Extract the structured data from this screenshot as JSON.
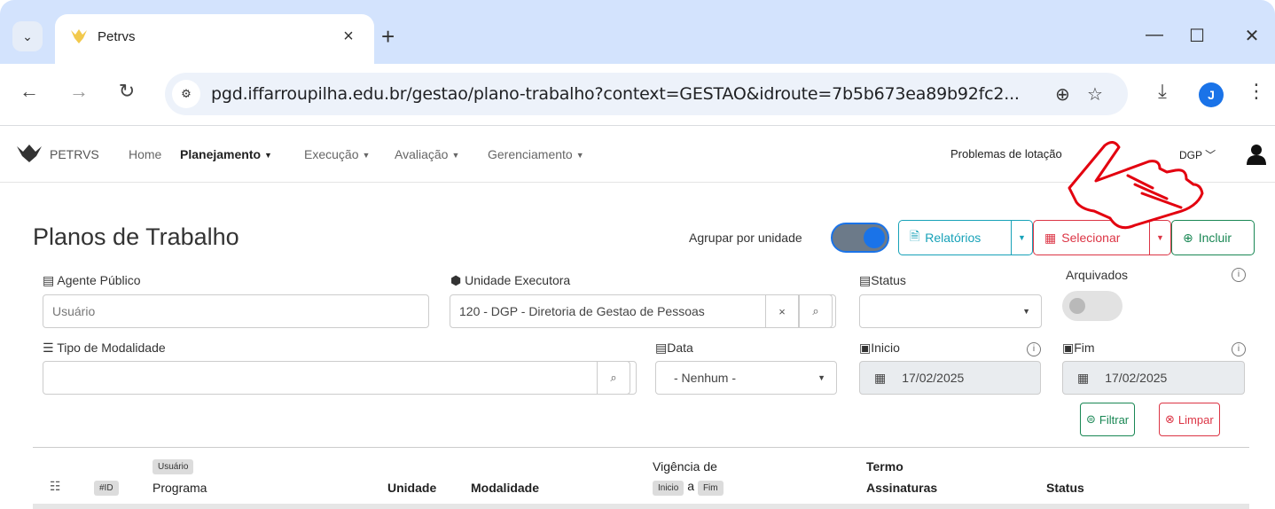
{
  "browser": {
    "tab_title": "Petrvs",
    "tab_close": "×",
    "new_tab": "+",
    "url": "pgd.iffarroupilha.edu.br/gestao/plano-trabalho?context=GESTAO&idroute=7b5b673ea89b92fc2...",
    "profile_initial": "J",
    "icons": [
      "tab-search-icon",
      "back-icon",
      "forward-icon",
      "reload-icon",
      "site-settings-icon",
      "zoom-icon",
      "bookmark-star-icon",
      "download-icon",
      "menu-dots-icon",
      "minimize-icon",
      "maximize-icon",
      "close-icon"
    ]
  },
  "nav": {
    "brand": "PETRVS",
    "items": [
      {
        "label": "Home",
        "bold": false,
        "caret": false
      },
      {
        "label": "Planejamento",
        "bold": true,
        "caret": true
      },
      {
        "label": "Execução",
        "bold": false,
        "caret": true
      },
      {
        "label": "Avaliação",
        "bold": false,
        "caret": true
      },
      {
        "label": "Gerenciamento",
        "bold": false,
        "caret": true
      }
    ],
    "problems": "Problemas de lotação",
    "unit": "DGP"
  },
  "page": {
    "title": "Planos de Trabalho",
    "group_label": "Agrupar por unidade",
    "group_toggle_on": true,
    "buttons": {
      "reports": "Relatórios",
      "select": "Selecionar",
      "include": "Incluir"
    }
  },
  "filters": {
    "agent_label": "Agente Público",
    "agent_placeholder": "Usuário",
    "unit_label": "Unidade Executora",
    "unit_value": "120 - DGP - Diretoria de Gestao de Pessoas",
    "unit_clear": "×",
    "status_label": "Status",
    "archived_label": "Arquivados",
    "modality_label": "Tipo de Modalidade",
    "date_label": "Data",
    "date_value": "- Nenhum -",
    "start_label": "Inicio",
    "start_value": "17/02/2025",
    "end_label": "Fim",
    "end_value": "17/02/2025",
    "filter_button": "Filtrar",
    "clear_button": "Limpar"
  },
  "table": {
    "id_badge": "#ID",
    "user_badge": "Usuário",
    "program": "Programa",
    "unit": "Unidade",
    "modality": "Modalidade",
    "validity": "Vigência de",
    "start_badge": "Inicio",
    "a": "a",
    "end_badge": "Fim",
    "term": "Termo",
    "signatures": "Assinaturas",
    "status": "Status"
  },
  "colors": {
    "primary": "#1a73e8",
    "info": "#17a2b8",
    "danger": "#dc3545",
    "success": "#198754",
    "annotation": "#e3000f"
  }
}
